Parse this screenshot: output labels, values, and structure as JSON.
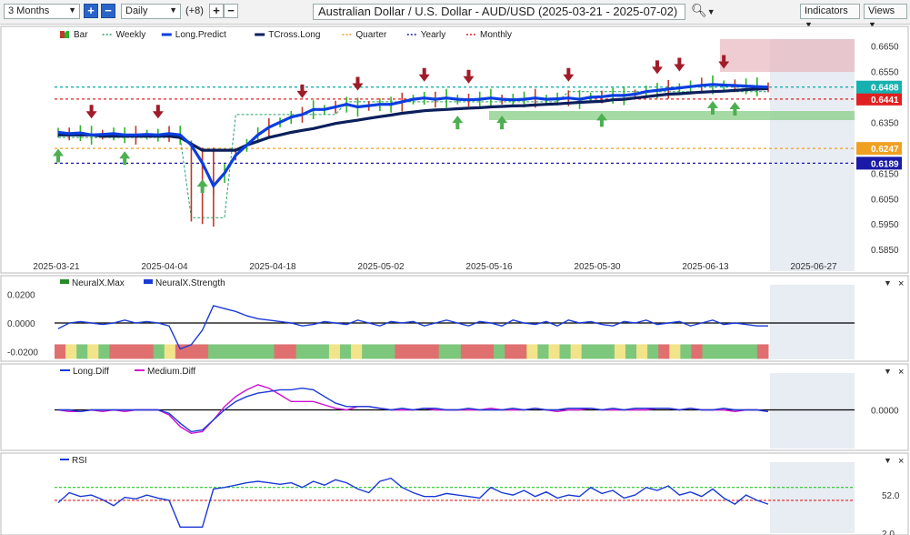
{
  "toolbar": {
    "range": "3 Months",
    "interval": "Daily",
    "offset": "(+8)",
    "title": "Australian Dollar / U.S. Dollar - AUD/USD (2025-03-21 - 2025-07-02)",
    "indicators": "Indicators",
    "views": "Views"
  },
  "legend_main": [
    {
      "name": "Bar",
      "color": "#c0392b"
    },
    {
      "name": "Weekly",
      "color": "#27a36a"
    },
    {
      "name": "Long.Predict",
      "color": "#0a3ee0"
    },
    {
      "name": "TCross.Long",
      "color": "#0b1f5c"
    },
    {
      "name": "Quarter",
      "color": "#f0a020"
    },
    {
      "name": "Yearly",
      "color": "#1a1aa8"
    },
    {
      "name": "Monthly",
      "color": "#e02020"
    }
  ],
  "legend_neural": [
    {
      "name": "NeuralX.Max",
      "color": "#2a8a2a"
    },
    {
      "name": "NeuralX.Strength",
      "color": "#1a3ad8"
    }
  ],
  "legend_diff": [
    {
      "name": "Long.Diff",
      "color": "#1a3ad8"
    },
    {
      "name": "Medium.Diff",
      "color": "#d010d0"
    }
  ],
  "legend_rsi": [
    {
      "name": "RSI",
      "color": "#1a3ad8"
    }
  ],
  "colors": {
    "up": "#2bb32b",
    "down": "#c0392b",
    "long_predict": "#0a3ee0",
    "tcross": "#0b1f5c",
    "weekly": "#27a36a",
    "quarter": "#f0a020",
    "yearly": "#1a1aa8",
    "monthly": "#e02020",
    "accent_cyan": "#17b0b0"
  },
  "chart_data": [
    {
      "type": "line",
      "name": "price",
      "x_ticks": [
        "2025-03-21",
        "2025-04-04",
        "2025-04-18",
        "2025-05-02",
        "2025-05-16",
        "2025-05-30",
        "2025-06-13",
        "2025-06-27"
      ],
      "y_ticks": [
        0.585,
        0.595,
        0.605,
        0.615,
        0.625,
        0.635,
        0.645,
        0.655,
        0.665
      ],
      "ylim": [
        0.5815,
        0.6705
      ],
      "xlim": [
        0,
        79
      ],
      "series": [
        {
          "name": "Long.Predict",
          "values": [
            0.631,
            0.6305,
            0.6308,
            0.63,
            0.6302,
            0.6305,
            0.63,
            0.63,
            0.6302,
            0.63,
            0.6305,
            0.63,
            0.626,
            0.619,
            0.61,
            0.615,
            0.622,
            0.626,
            0.63,
            0.633,
            0.635,
            0.637,
            0.638,
            0.64,
            0.64,
            0.641,
            0.642,
            0.641,
            0.6415,
            0.642,
            0.642,
            0.643,
            0.644,
            0.6445,
            0.644,
            0.6445,
            0.644,
            0.6438,
            0.644,
            0.6445,
            0.644,
            0.6438,
            0.644,
            0.6445,
            0.644,
            0.6442,
            0.6445,
            0.644,
            0.6448,
            0.645,
            0.6455,
            0.6455,
            0.646,
            0.647,
            0.6475,
            0.648,
            0.6485,
            0.649,
            0.6495,
            0.6498,
            0.6496,
            0.6494,
            0.6492,
            0.649,
            0.6488
          ]
        },
        {
          "name": "TCross.Long",
          "values": [
            0.63,
            0.63,
            0.63,
            0.63,
            0.6295,
            0.6295,
            0.6295,
            0.6295,
            0.6295,
            0.6295,
            0.6295,
            0.629,
            0.6265,
            0.624,
            0.624,
            0.624,
            0.624,
            0.626,
            0.6275,
            0.629,
            0.63,
            0.631,
            0.6318,
            0.6325,
            0.6335,
            0.6345,
            0.6352,
            0.6358,
            0.6365,
            0.6372,
            0.6378,
            0.6385,
            0.639,
            0.6395,
            0.6398,
            0.64,
            0.6403,
            0.6405,
            0.6407,
            0.641,
            0.6412,
            0.6414,
            0.6415,
            0.6418,
            0.642,
            0.6422,
            0.6425,
            0.6428,
            0.643,
            0.6432,
            0.6438,
            0.644,
            0.6445,
            0.645,
            0.6455,
            0.646,
            0.6462,
            0.6465,
            0.6468,
            0.647,
            0.6472,
            0.6475,
            0.6478,
            0.648,
            0.6482
          ]
        }
      ],
      "levels": [
        {
          "name": "Quarter",
          "value": 0.6247,
          "label": "0.6247",
          "color": "#f0a020"
        },
        {
          "name": "Yearly",
          "value": 0.6189,
          "label": "0.6189",
          "color": "#1a1aa8"
        },
        {
          "name": "Monthly",
          "value": 0.6441,
          "label": "0.6441",
          "color": "#e02020"
        },
        {
          "name": "Current",
          "value": 0.6488,
          "label": "0.6488",
          "color": "#17b0b0"
        }
      ],
      "up_signals": [
        0,
        6,
        13,
        36,
        40,
        49,
        59,
        61
      ],
      "down_signals": [
        3,
        9,
        22,
        27,
        33,
        37,
        46,
        54,
        56,
        60
      ]
    },
    {
      "type": "line",
      "name": "neuralx",
      "y_ticks": [
        0.02,
        0.0,
        -0.02
      ],
      "ylim": [
        -0.024,
        0.024
      ],
      "series": [
        {
          "name": "NeuralX.Strength",
          "values": [
            -0.004,
            0.0,
            0.001,
            0.0,
            -0.001,
            0.0,
            0.002,
            0.0,
            0.001,
            0.0,
            -0.002,
            -0.018,
            -0.015,
            -0.005,
            0.012,
            0.01,
            0.008,
            0.005,
            0.003,
            0.002,
            0.001,
            0.0,
            -0.002,
            -0.001,
            0.001,
            0.0,
            -0.001,
            0.002,
            0.0,
            -0.002,
            0.001,
            0.0,
            0.001,
            -0.002,
            0.0,
            0.002,
            0.0,
            -0.002,
            0.001,
            0.0,
            -0.002,
            0.002,
            0.0,
            -0.001,
            0.001,
            -0.002,
            0.002,
            0.0,
            0.001,
            -0.001,
            -0.002,
            0.001,
            0.0,
            0.002,
            -0.001,
            0.0,
            0.001,
            -0.002,
            0.0,
            0.002,
            -0.001,
            0.0,
            -0.001,
            -0.002,
            -0.002
          ]
        },
        {
          "name": "NeuralX.Max",
          "colors": [
            "r",
            "y",
            "g",
            "y",
            "g",
            "r",
            "r",
            "r",
            "r",
            "g",
            "y",
            "r",
            "r",
            "r",
            "g",
            "g",
            "g",
            "g",
            "g",
            "g",
            "r",
            "r",
            "g",
            "g",
            "g",
            "y",
            "g",
            "y",
            "g",
            "g",
            "g",
            "r",
            "r",
            "r",
            "r",
            "g",
            "g",
            "r",
            "r",
            "r",
            "g",
            "r",
            "r",
            "y",
            "g",
            "y",
            "g",
            "y",
            "g",
            "g",
            "g",
            "y",
            "g",
            "y",
            "g",
            "r",
            "y",
            "g",
            "r",
            "g",
            "g",
            "g",
            "g",
            "g",
            "r"
          ]
        }
      ],
      "zero": 0.0
    },
    {
      "type": "line",
      "name": "diff",
      "y_ticks": [
        0.0
      ],
      "ylim": [
        -0.022,
        0.022
      ],
      "series": [
        {
          "name": "Long.Diff",
          "values": [
            0.0,
            0.0,
            -0.001,
            0.0,
            0.0,
            0.0,
            0.0,
            0.0,
            0.0,
            0.0,
            -0.002,
            -0.008,
            -0.013,
            -0.012,
            -0.006,
            0.0,
            0.005,
            0.008,
            0.01,
            0.011,
            0.012,
            0.012,
            0.013,
            0.012,
            0.008,
            0.004,
            0.002,
            0.002,
            0.002,
            0.001,
            0.0,
            0.001,
            0.0,
            0.001,
            0.001,
            0.0,
            0.0,
            0.001,
            0.0,
            0.0,
            0.0,
            0.001,
            0.0,
            0.001,
            0.0,
            0.0,
            0.001,
            0.001,
            0.001,
            0.0,
            0.001,
            0.0,
            0.001,
            0.001,
            0.001,
            0.001,
            0.0,
            0.001,
            0.0,
            0.0,
            0.001,
            0.0,
            0.0,
            0.0,
            -0.001
          ]
        },
        {
          "name": "Medium.Diff",
          "values": [
            0.0,
            -0.001,
            -0.001,
            0.0,
            -0.001,
            0.0,
            -0.001,
            0.0,
            0.0,
            0.0,
            -0.003,
            -0.01,
            -0.014,
            -0.013,
            -0.006,
            0.002,
            0.008,
            0.012,
            0.015,
            0.013,
            0.009,
            0.005,
            0.005,
            0.005,
            0.003,
            0.001,
            0.0,
            0.002,
            0.002,
            0.001,
            0.0,
            0.0,
            0.0,
            0.001,
            0.0,
            0.0,
            0.0,
            0.0,
            0.0,
            0.001,
            0.0,
            0.0,
            0.0,
            0.001,
            0.0,
            -0.001,
            0.0,
            0.0,
            0.001,
            0.0,
            0.0,
            0.0,
            0.0,
            0.0,
            0.001,
            0.001,
            0.0,
            0.001,
            0.0,
            0.0,
            0.0,
            -0.001,
            0.0,
            0.0,
            -0.001
          ]
        }
      ],
      "zero": 0.0
    },
    {
      "type": "line",
      "name": "rsi",
      "y_ticks": [
        52.0,
        2.0
      ],
      "ylim": [
        2,
        95
      ],
      "series": [
        {
          "name": "RSI",
          "values": [
            42,
            55,
            50,
            52,
            46,
            38,
            49,
            47,
            52,
            48,
            45,
            10,
            10,
            10,
            60,
            62,
            65,
            68,
            70,
            68,
            66,
            68,
            62,
            70,
            65,
            72,
            68,
            60,
            55,
            70,
            74,
            62,
            55,
            50,
            50,
            54,
            52,
            50,
            48,
            62,
            55,
            52,
            58,
            50,
            56,
            48,
            52,
            50,
            62,
            54,
            58,
            48,
            52,
            62,
            58,
            64,
            52,
            56,
            50,
            60,
            48,
            40,
            52,
            45,
            40
          ]
        }
      ],
      "levels": [
        {
          "name": "upper",
          "value": 62,
          "color": "#22cc22"
        },
        {
          "name": "lower",
          "value": 45,
          "color": "#e02020"
        }
      ]
    }
  ]
}
